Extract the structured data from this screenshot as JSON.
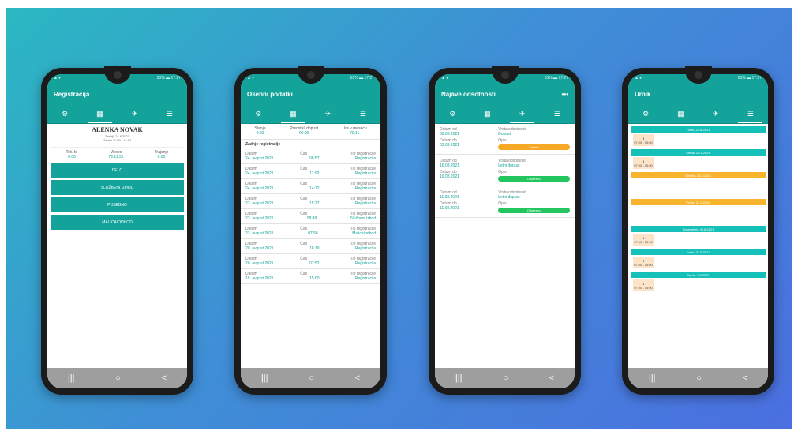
{
  "phones": [
    {
      "title": "Registracija",
      "status_left": "▲▼",
      "status_right": "83% ▬ 17:27",
      "tabs": [
        "⚙",
        "▦",
        "✈",
        "☰"
      ],
      "active_tab": 1,
      "name": "ALENKA NOVAK",
      "sub1": "Zadnji, 24.8.2021",
      "sub2": "Zadnji 11:09 - 14:12",
      "stats": [
        {
          "label": "Tek. b.",
          "value": "0:00"
        },
        {
          "label": "Mesec",
          "value": "79:11:31"
        },
        {
          "label": "Trajanje",
          "value": "0:00"
        }
      ],
      "buttons": [
        "DELO",
        "SLUŽBENI IZHOD",
        "POSEBNO",
        "MALICA/ODHOD"
      ]
    },
    {
      "title": "Osebni podatki",
      "status_left": "▲▼",
      "status_right": "83% ▬ 17:27",
      "tabs": [
        "⚙",
        "▦",
        "✈",
        "☰"
      ],
      "active_tab": 1,
      "summary": [
        {
          "label": "Stanje",
          "value": "0:00"
        },
        {
          "label": "Preostali dopust",
          "value": "00:00"
        },
        {
          "label": "Ure v mesecu",
          "value": "79:11"
        }
      ],
      "section": "Zadnje registracije",
      "entries": [
        {
          "date": "24. avgust 2021",
          "time": "08:57",
          "type": "Registracija"
        },
        {
          "date": "24. avgust 2021",
          "time": "11:09",
          "type": "Registracija"
        },
        {
          "date": "24. avgust 2021",
          "time": "14:12",
          "type": "Registracija"
        },
        {
          "date": "23. avgust 2021",
          "time": "15:27",
          "type": "Registracija"
        },
        {
          "date": "23. avgust 2021",
          "time": "08:49",
          "type": "Službeni izhod"
        },
        {
          "date": "23. avgust 2021",
          "time": "07:56",
          "type": "Malica/odhod"
        },
        {
          "date": "20. avgust 2021",
          "time": "16:10",
          "type": "Registracija"
        },
        {
          "date": "20. avgust 2021",
          "time": "07:52",
          "type": "Registracija"
        },
        {
          "date": "19. avgust 2021",
          "time": "15:00",
          "type": "Registracija"
        }
      ],
      "col_labels": {
        "date": "Datum",
        "time": "Čas",
        "type": "Tip registracije"
      }
    },
    {
      "title": "Najave odsotnosti",
      "status_left": "▲▼",
      "status_right": "83% ▬ 17:27",
      "tabs": [
        "⚙",
        "▦",
        "✈",
        "☰"
      ],
      "active_tab": 2,
      "menu": "•••",
      "requests": [
        {
          "from": "30.08.2021",
          "to": "03.09.2021",
          "kind": "Dopust",
          "status": "Odprto",
          "color": "#f7a826"
        },
        {
          "from": "16.08.2021",
          "to": "19.08.2021",
          "kind": "Letni dopust",
          "status": "Odobreno",
          "color": "#22c55e"
        },
        {
          "from": "11.08.2021",
          "to": "11.08.2021",
          "kind": "Letni dopust",
          "status": "Odobreno",
          "color": "#22c55e"
        }
      ],
      "col_labels": {
        "from": "Datum od",
        "to": "Datum do",
        "kind": "Vrsta odsotnosti",
        "note": "Opis"
      }
    },
    {
      "title": "Urnik",
      "status_left": "▲▼",
      "status_right": "83% ▬ 17:27",
      "tabs": [
        "⚙",
        "▦",
        "✈",
        "☰"
      ],
      "active_tab": 3,
      "days": [
        {
          "label": "Torek, 24.8.2021",
          "kind": "teal",
          "slot": "8",
          "time": "07:00 - 15:00"
        },
        {
          "label": "Sreda, 25.8.2021",
          "kind": "teal",
          "slot": "8",
          "time": "07:00 - 15:00"
        },
        {
          "label": "Četrtek, 26.8.2021",
          "kind": "orange",
          "slot": "",
          "time": ""
        },
        {
          "label": "Petek, 27.8.2021",
          "kind": "orange",
          "slot": "",
          "time": ""
        },
        {
          "label": "Ponedeljek, 30.8.2021",
          "kind": "teal",
          "slot": "8",
          "time": "07:00 - 15:00"
        },
        {
          "label": "Torek, 31.8.2021",
          "kind": "teal",
          "slot": "8",
          "time": "07:00 - 15:00"
        },
        {
          "label": "Sreda, 1.9.2021",
          "kind": "teal",
          "slot": "8",
          "time": "07:00 - 15:00"
        }
      ]
    }
  ],
  "navbar": [
    "|||",
    "○",
    "<"
  ],
  "colors": {
    "primary": "#14a39a",
    "orange": "#f7b42c",
    "green": "#22c55e",
    "peach": "#fde3c8"
  }
}
